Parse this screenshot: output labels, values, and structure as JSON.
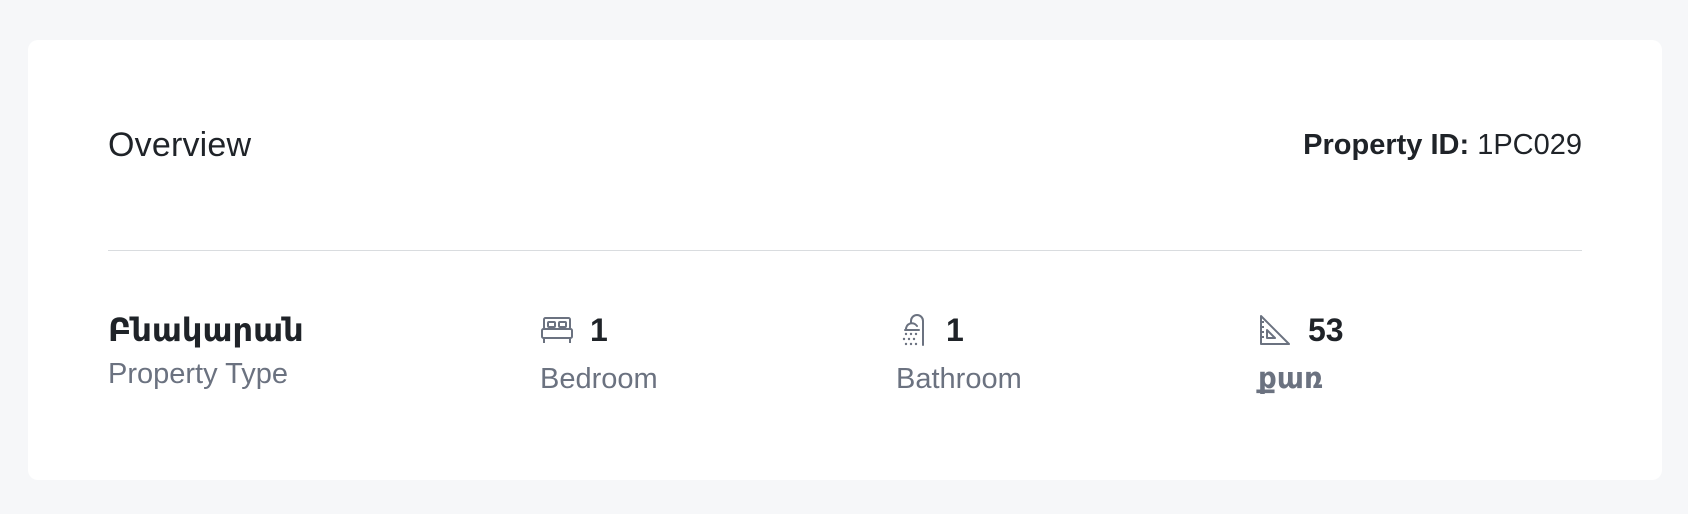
{
  "overview": {
    "title": "Overview",
    "property_id_label": "Property ID:",
    "property_id_value": "1PC029"
  },
  "stats": {
    "property_type": {
      "value": "Բնակարան",
      "caption": "Property Type"
    },
    "bedroom": {
      "icon": "bed-icon",
      "value": "1",
      "caption": "Bedroom"
    },
    "bathroom": {
      "icon": "shower-icon",
      "value": "1",
      "caption": "Bathroom"
    },
    "area": {
      "icon": "area-ruler-icon",
      "value": "53",
      "caption": "քառ"
    }
  },
  "colors": {
    "page_bg": "#f6f7f9",
    "card_bg": "#ffffff",
    "text_primary": "#1f2328",
    "text_secondary": "#6b7280",
    "divider": "#d9dcdf"
  }
}
